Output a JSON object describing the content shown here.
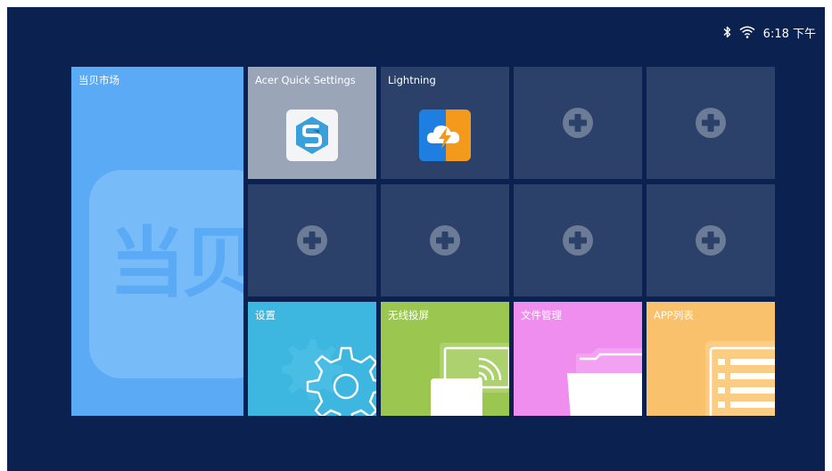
{
  "status_bar": {
    "time": "6:18 下午",
    "bluetooth_icon": "bluetooth-icon",
    "wifi_icon": "wifi-icon"
  },
  "tiles": {
    "market": {
      "label": "当贝市场",
      "watermark": "当贝",
      "color": "#5aaaf5"
    },
    "acer_quick_settings": {
      "label": "Acer Quick Settings",
      "icon": "acer-quick-settings-icon",
      "color": "#9aa6b8"
    },
    "lightning": {
      "label": "Lightning",
      "icon": "lightning-icon",
      "color": "#2c416a"
    },
    "settings": {
      "label": "设置",
      "icon": "gear-icon",
      "color": "#3db6e0"
    },
    "screen_mirror": {
      "label": "无线投屏",
      "icon": "screen-cast-icon",
      "color": "#9bc650"
    },
    "file_manager": {
      "label": "文件管理",
      "icon": "folder-icon",
      "color": "#f08ef0"
    },
    "app_list": {
      "label": "APP列表",
      "icon": "list-icon",
      "color": "#f9c16c"
    }
  },
  "empty_slot_icon": "plus-circle-icon"
}
